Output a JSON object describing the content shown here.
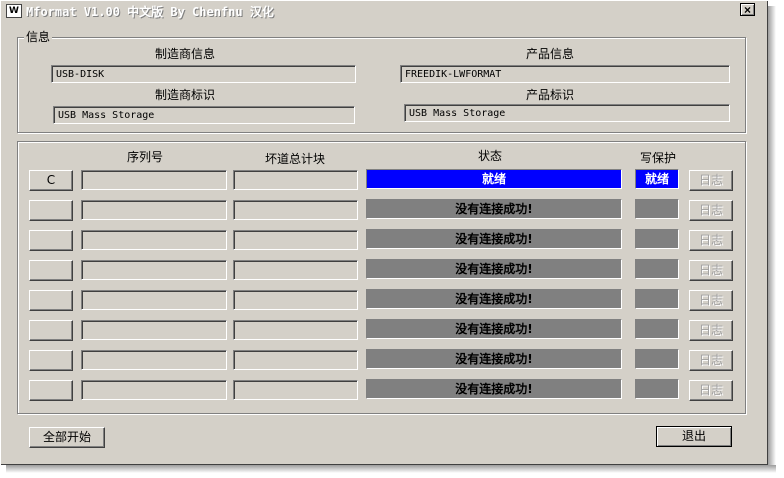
{
  "window": {
    "title": "Mformat V1.00 中文版 By Chenfnu 汉化",
    "close_label": "×",
    "app_icon": "W"
  },
  "info": {
    "legend": "信息",
    "vendor_info_label": "制造商信息",
    "vendor_info_value": "USB-DISK",
    "product_info_label": "产品信息",
    "product_info_value": "FREEDIK-LWFORMAT",
    "vendor_id_label": "制造商标识",
    "vendor_id_value": "USB Mass Storage",
    "product_id_label": "产品标识",
    "product_id_value": "USB Mass Storage"
  },
  "table": {
    "headers": {
      "serial": "序列号",
      "bad_blocks": "坏道总计块",
      "status": "状态",
      "write_protect": "写保护"
    },
    "rows": [
      {
        "drive": "C",
        "serial": "",
        "bad_blocks": "",
        "status": "就绪",
        "write_protect": "就绪",
        "log": "日志",
        "ready": true
      },
      {
        "drive": "",
        "serial": "",
        "bad_blocks": "",
        "status": "没有连接成功!",
        "write_protect": "",
        "log": "日志",
        "ready": false
      },
      {
        "drive": "",
        "serial": "",
        "bad_blocks": "",
        "status": "没有连接成功!",
        "write_protect": "",
        "log": "日志",
        "ready": false
      },
      {
        "drive": "",
        "serial": "",
        "bad_blocks": "",
        "status": "没有连接成功!",
        "write_protect": "",
        "log": "日志",
        "ready": false
      },
      {
        "drive": "",
        "serial": "",
        "bad_blocks": "",
        "status": "没有连接成功!",
        "write_protect": "",
        "log": "日志",
        "ready": false
      },
      {
        "drive": "",
        "serial": "",
        "bad_blocks": "",
        "status": "没有连接成功!",
        "write_protect": "",
        "log": "日志",
        "ready": false
      },
      {
        "drive": "",
        "serial": "",
        "bad_blocks": "",
        "status": "没有连接成功!",
        "write_protect": "",
        "log": "日志",
        "ready": false
      },
      {
        "drive": "",
        "serial": "",
        "bad_blocks": "",
        "status": "没有连接成功!",
        "write_protect": "",
        "log": "日志",
        "ready": false
      }
    ]
  },
  "footer": {
    "start_all_label": "全部开始",
    "exit_label": "退出"
  },
  "colors": {
    "ready": "#0000ff",
    "not_connected": "#808080",
    "face": "#d4d0c8"
  }
}
